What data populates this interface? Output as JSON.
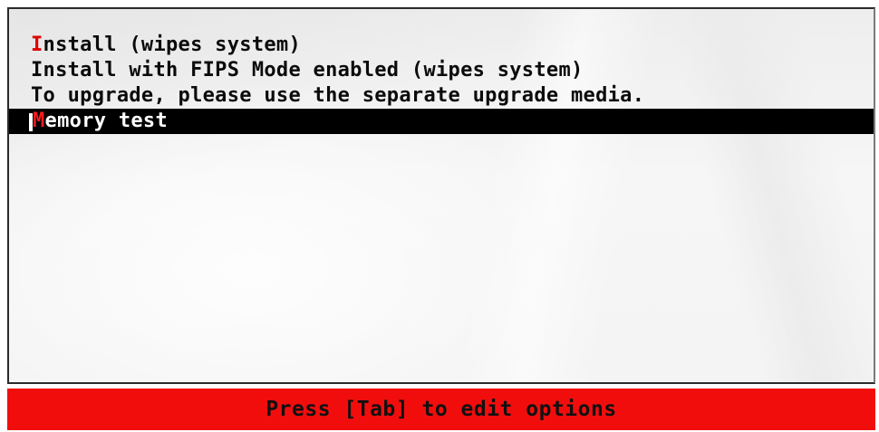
{
  "menu": {
    "items": [
      {
        "hotkey": "I",
        "rest": "nstall (wipes system)",
        "selected": false
      },
      {
        "hotkey": "I",
        "rest": "nstall with FIPS Mode enabled (wipes system)",
        "selected": false
      },
      {
        "hotkey": "",
        "rest": "To upgrade, please use the separate upgrade media.",
        "selected": false
      },
      {
        "hotkey": "M",
        "rest": "emory test",
        "selected": true
      }
    ]
  },
  "footer": {
    "hint": "Press [Tab] to edit options"
  },
  "colors": {
    "accent_red": "#f20d0d",
    "hotkey_red": "#e10000",
    "selection_bg": "#000000"
  }
}
